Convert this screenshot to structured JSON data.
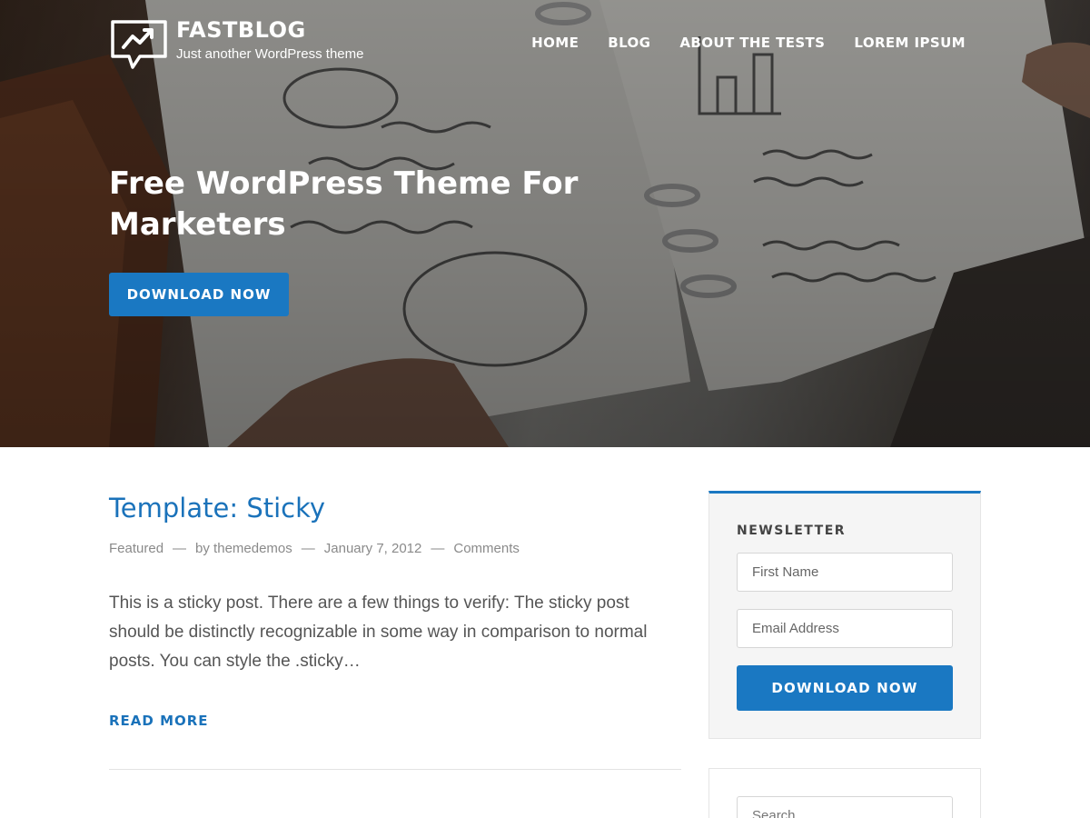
{
  "site": {
    "title": "FASTBLOG",
    "tagline": "Just another WordPress theme",
    "logo_icon": "chart-speech-bubble-icon"
  },
  "nav": {
    "items": [
      {
        "label": "HOME"
      },
      {
        "label": "BLOG"
      },
      {
        "label": "ABOUT THE TESTS"
      },
      {
        "label": "LOREM IPSUM"
      }
    ]
  },
  "hero": {
    "title": "Free WordPress Theme For Marketers",
    "button_label": "DOWNLOAD NOW"
  },
  "post": {
    "title": "Template: Sticky",
    "category": "Featured",
    "author": "by themedemos",
    "date": "January 7, 2012",
    "comments": "Comments",
    "meta_separator": "—",
    "excerpt": "This is a sticky post. There are a few things to verify: The sticky post should be distinctly recognizable in some way in comparison to normal posts. You can style the .sticky…",
    "read_more": "READ MORE"
  },
  "newsletter": {
    "title": "NEWSLETTER",
    "first_name_placeholder": "First Name",
    "email_placeholder": "Email Address",
    "button_label": "DOWNLOAD NOW"
  },
  "search": {
    "placeholder": "Search ..."
  },
  "colors": {
    "accent": "#1a78c2",
    "link": "#1a72ba",
    "meta_text": "#8a8a8a"
  }
}
